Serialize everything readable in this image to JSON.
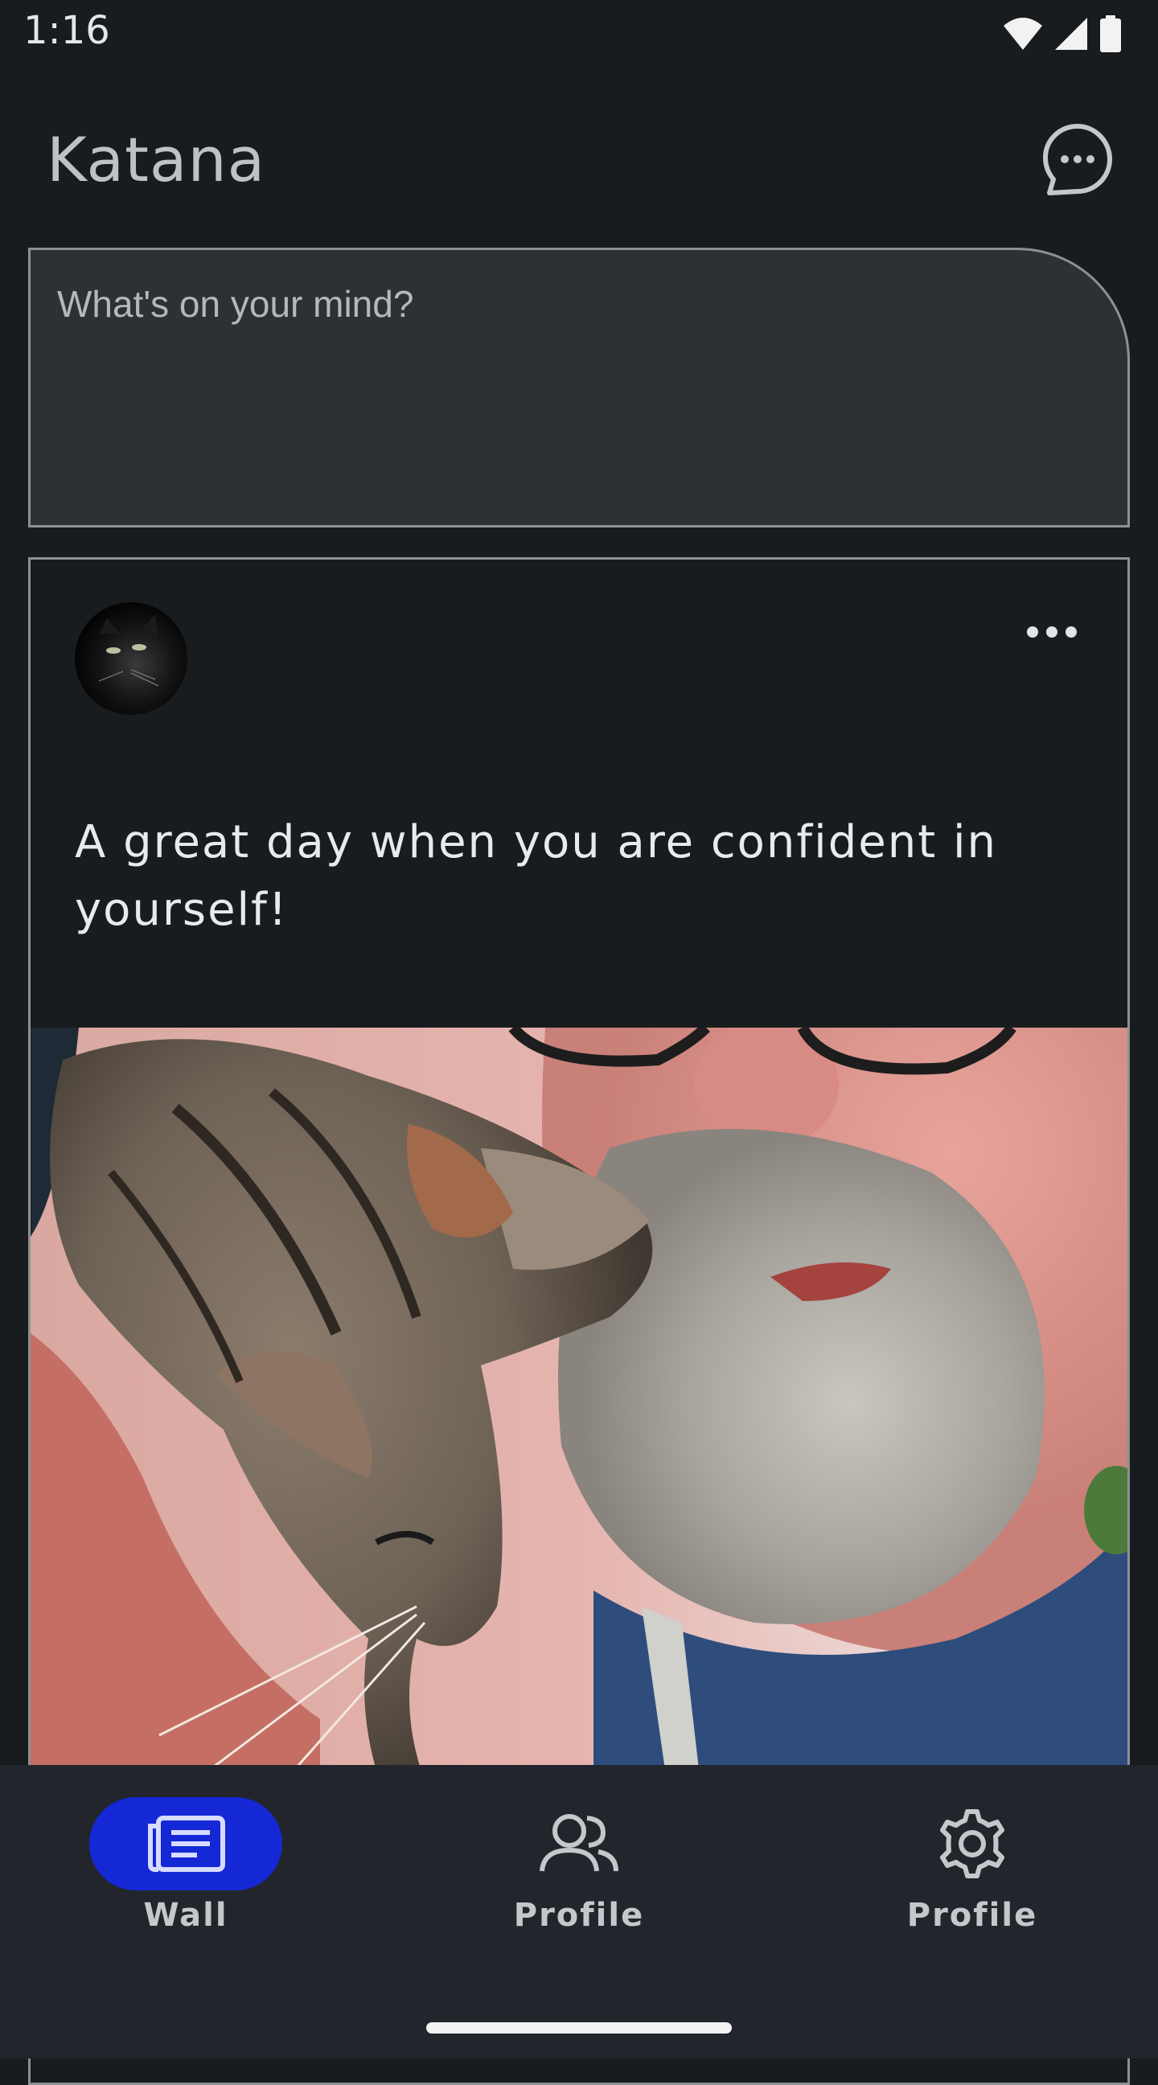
{
  "status_bar": {
    "time": "1:16",
    "icons": [
      "wifi-icon",
      "signal-icon",
      "battery-icon"
    ]
  },
  "header": {
    "title": "Katana",
    "chat_icon": "chat-bubble-icon"
  },
  "composer": {
    "placeholder": "What's on your mind?",
    "value": ""
  },
  "post": {
    "avatar": "avatar",
    "menu_icon": "more-horizontal-icon",
    "text": "A great day when you are confident in yourself!"
  },
  "bottom_nav": {
    "items": [
      {
        "label": "Wall",
        "icon": "wall-icon",
        "active": true
      },
      {
        "label": "Profile",
        "icon": "people-icon",
        "active": false
      },
      {
        "label": "Profile",
        "icon": "gear-icon",
        "active": false
      }
    ]
  },
  "colors": {
    "background": "#191c1e",
    "accent": "#1428d6",
    "nav_background": "#22262c",
    "composer_fill": "#2d3133",
    "border": "#8c9194"
  }
}
